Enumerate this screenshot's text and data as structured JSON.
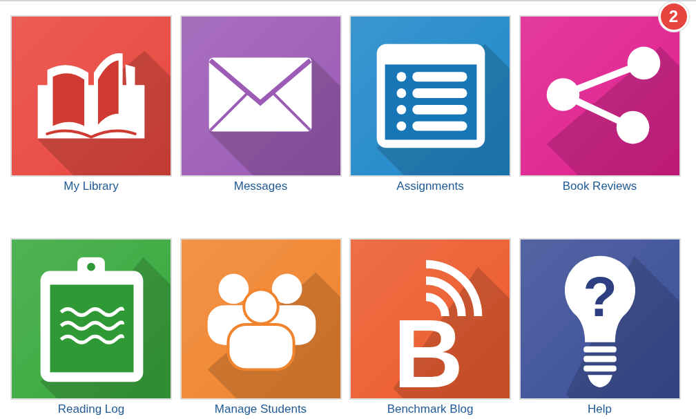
{
  "tiles": [
    {
      "label": "My Library",
      "color": "#e8473e"
    },
    {
      "label": "Messages",
      "color": "#9c5bb5"
    },
    {
      "label": "Assignments",
      "color": "#1f88c9"
    },
    {
      "label": "Book Reviews",
      "color": "#e0208f",
      "badge": "2"
    },
    {
      "label": "Reading Log",
      "color": "#38a83c"
    },
    {
      "label": "Manage Students",
      "color": "#f0842e"
    },
    {
      "label": "Benchmark Blog",
      "color": "#ec5b2d",
      "icon_text": "B"
    },
    {
      "label": "Help",
      "color": "#3c4f98",
      "icon_text": "?"
    }
  ]
}
